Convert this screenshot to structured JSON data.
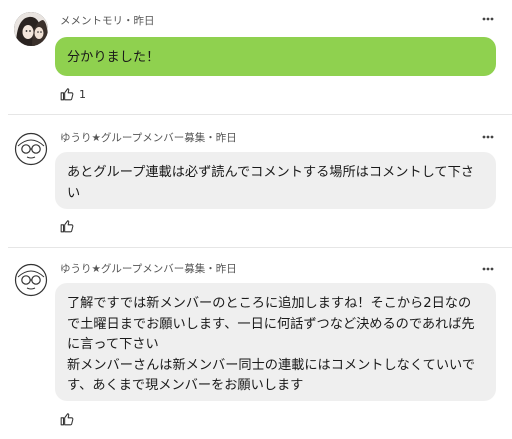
{
  "comments": [
    {
      "author": "メメントモリ",
      "time": "昨日",
      "text": "分かりました！",
      "like_count": "1",
      "bubble_color": "#8fd14f",
      "avatar_icon": "photo-avatar"
    },
    {
      "author": "ゆうり★グループメンバー募集",
      "time": "昨日",
      "text": "あとグループ連載は必ず読んでコメントする場所はコメントして下さい",
      "like_count": "",
      "bubble_color": "#efefef",
      "avatar_icon": "glasses-face-avatar"
    },
    {
      "author": "ゆうり★グループメンバー募集",
      "time": "昨日",
      "text": "了解ですでは新メンバーのところに追加しますね！そこから2日なので土曜日までお願いします、一日に何話ずつなど決めるのであれば先に言って下さい\n新メンバーさんは新メンバー同士の連載にはコメントしなくていいです、あくまで現メンバーをお願いします",
      "like_count": "",
      "bubble_color": "#efefef",
      "avatar_icon": "glasses-face-avatar"
    }
  ],
  "meta_separator": "・",
  "more_icon": "more-dots-icon",
  "like_icon": "thumbs-up-icon"
}
